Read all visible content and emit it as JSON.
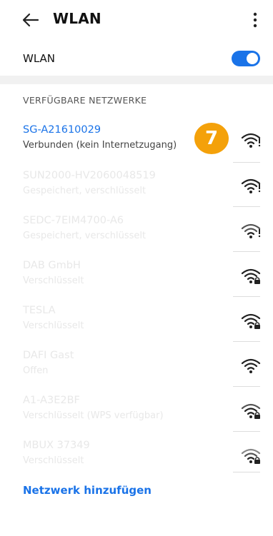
{
  "header": {
    "title": "WLAN"
  },
  "wlan": {
    "label": "WLAN",
    "enabled": true
  },
  "networks": {
    "section_title": "VERFÜGBARE NETZWERKE",
    "items": [
      {
        "name": "SG-A21610029",
        "status": "Verbunden (kein Internetzugang)",
        "secured": false
      },
      {
        "name": "SUN2000-HV2060048519",
        "status": "Gespeichert, verschlüsselt",
        "secured": false
      },
      {
        "name": "SEDC-7EIM4700-A6",
        "status": "Gespeichert, verschlüsselt",
        "secured": false
      },
      {
        "name": "DAB GmbH",
        "status": "Verschlüsselt",
        "secured": true
      },
      {
        "name": "TESLA",
        "status": "Verschlüsselt",
        "secured": true
      },
      {
        "name": "DAFI Gast",
        "status": "Offen",
        "secured": false
      },
      {
        "name": "A1-A3E2BF",
        "status": "Verschlüsselt (WPS verfügbar)",
        "secured": true
      },
      {
        "name": "MBUX 37349",
        "status": "Verschlüsselt",
        "secured": true
      }
    ]
  },
  "badge": {
    "label": "7",
    "color": "#f4a10a"
  },
  "footer": {
    "add_network_label": "Netzwerk hinzufügen"
  },
  "colors": {
    "accent": "#1a73e8",
    "badge": "#f4a10a"
  },
  "icons": {
    "back": "arrow-left-icon",
    "menu": "more-vert-icon",
    "wifi": "wifi-icon",
    "wifi_lock": "wifi-lock-icon"
  }
}
